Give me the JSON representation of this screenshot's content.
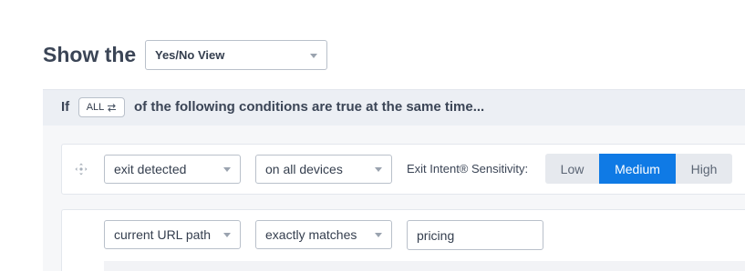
{
  "header": {
    "show_label": "Show the",
    "view_select": "Yes/No View"
  },
  "conditions": {
    "if_label": "If",
    "match_mode": "ALL",
    "match_icon": "swap-arrows-icon",
    "suffix": "of the following conditions are true at the same time..."
  },
  "rules": [
    {
      "trigger": "exit detected",
      "devices": "on all devices",
      "sensitivity_label": "Exit Intent® Sensitivity:",
      "sensitivity_options": [
        "Low",
        "Medium",
        "High"
      ],
      "sensitivity_selected": "Medium"
    },
    {
      "target": "current URL path",
      "operator": "exactly matches",
      "value": "pricing"
    }
  ],
  "colors": {
    "accent": "#0f7ae5",
    "band": "#eceff4"
  }
}
